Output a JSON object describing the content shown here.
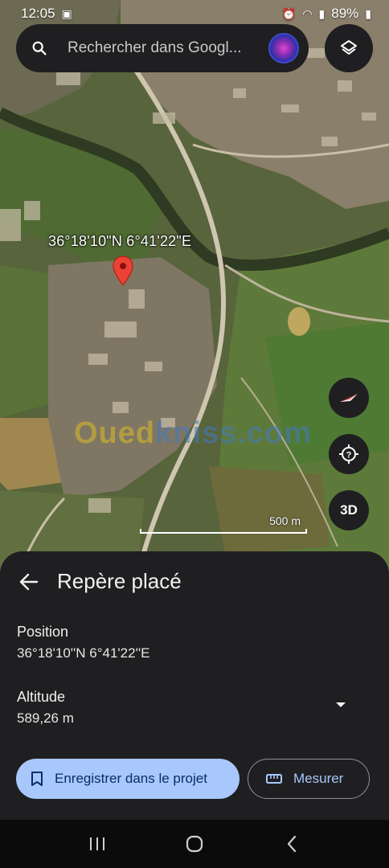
{
  "status_bar": {
    "time": "12:05",
    "battery": "89%"
  },
  "search": {
    "placeholder": "Rechercher dans Googl..."
  },
  "map": {
    "coordinates_label": "36°18'10\"N 6°41'22\"E",
    "watermark_prefix": "Oued",
    "watermark_rest": "kniss.com",
    "scale_label": "500 m",
    "btn_3d": "3D",
    "pin_color": "#ea4335"
  },
  "sheet": {
    "title": "Repère placé",
    "position_label": "Position",
    "position_value": "36°18'10''N 6°41'22''E",
    "altitude_label": "Altitude",
    "altitude_value": "589,26 m",
    "save_label": "Enregistrer dans le projet",
    "measure_label": "Mesurer"
  },
  "colors": {
    "sheet_bg": "#1f1f21",
    "primary_button": "#a8c7fa",
    "primary_text": "#062e6f"
  }
}
